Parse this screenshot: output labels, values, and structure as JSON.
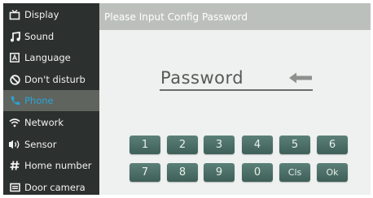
{
  "sidebar": {
    "items": [
      {
        "label": "Display",
        "icon": "display-icon",
        "active": false
      },
      {
        "label": "Sound",
        "icon": "music-note-icon",
        "active": false
      },
      {
        "label": "Language",
        "icon": "language-icon",
        "active": false
      },
      {
        "label": "Don't disturb",
        "icon": "do-not-disturb-icon",
        "active": false
      },
      {
        "label": "Phone",
        "icon": "phone-icon",
        "active": true
      },
      {
        "label": "Network",
        "icon": "wifi-icon",
        "active": false
      },
      {
        "label": "Sensor",
        "icon": "sensor-icon",
        "active": false
      },
      {
        "label": "Home number",
        "icon": "hash-icon",
        "active": false
      },
      {
        "label": "Door camera",
        "icon": "door-camera-icon",
        "active": false
      }
    ]
  },
  "dialog": {
    "title": "Please Input Config Password",
    "password_label": "Password",
    "backspace_icon": "backspace-arrow-icon"
  },
  "keypad": {
    "row1": [
      "1",
      "2",
      "3",
      "4",
      "5",
      "6"
    ],
    "row2": [
      "7",
      "8",
      "9",
      "0",
      "Cls",
      "Ok"
    ]
  },
  "colors": {
    "sidebar_bg": "#2c302e",
    "active_item_bg": "#5f645e",
    "active_item_text": "#2aa4d8",
    "title_bar_bg": "#bcc0bc",
    "key_bg": "#4b6e66"
  }
}
